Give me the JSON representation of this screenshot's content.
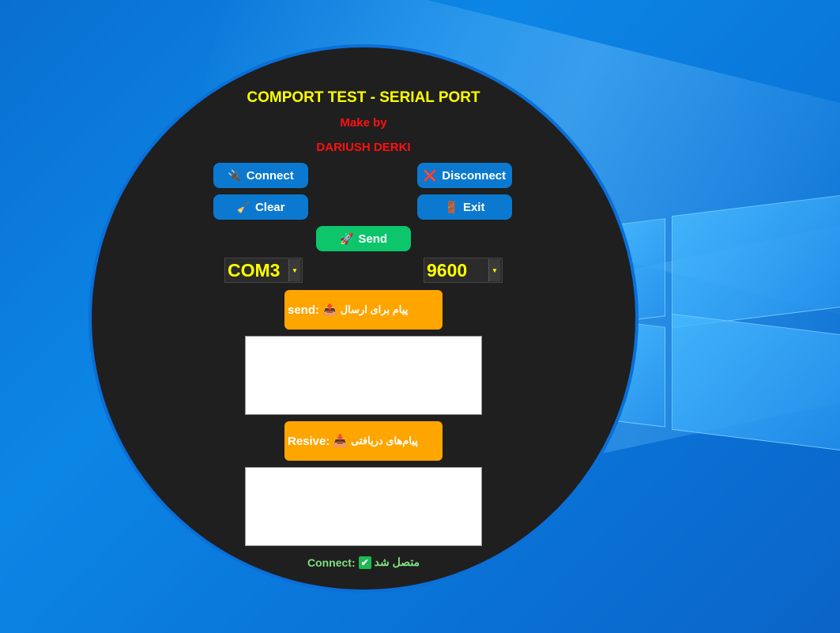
{
  "app": {
    "title": "COMPORT TEST - SERIAL PORT",
    "make_by": "Make by",
    "author": "DARIUSH DERKI"
  },
  "buttons": {
    "connect": "Connect",
    "disconnect": "Disconnect",
    "clear": "Clear",
    "exit": "Exit",
    "send": "Send"
  },
  "icons": {
    "connect": "plug-icon",
    "disconnect": "cross-mark-icon",
    "clear": "broom-icon",
    "exit": "door-icon",
    "send": "rocket-icon",
    "send_label": "outbox-tray-icon",
    "recv_label": "inbox-tray-icon",
    "status": "check-mark-icon"
  },
  "serial": {
    "port": "COM3",
    "baud": "9600"
  },
  "send_panel": {
    "prefix": "send:",
    "label_fa": "پیام برای ارسال",
    "value": ""
  },
  "receive_panel": {
    "prefix": "Resive:",
    "label_fa": "پیام‌های دریافتی",
    "value": ""
  },
  "status": {
    "prefix": "Connect:",
    "text_fa": "متصل شد"
  },
  "colors": {
    "title": "#ffff00",
    "author": "#ff1010",
    "button": "#0b79d0",
    "send_button": "#0dc66c",
    "label_box": "#ffa500",
    "status": "#7fe07f",
    "panel_bg": "#1f1f1f"
  }
}
